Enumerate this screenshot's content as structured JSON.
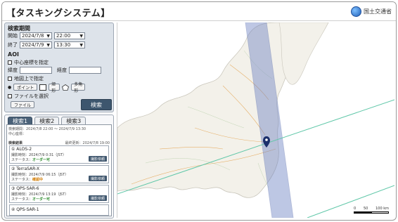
{
  "app": {
    "title": "【タスキングシステム】",
    "brand": "国土交通省"
  },
  "search": {
    "section_title": "検索期間",
    "start_label": "開始",
    "start_date": "2024/7/8",
    "start_time": "22:00",
    "end_label": "終了",
    "end_date": "2024/7/9",
    "end_time": "13:30",
    "aoi_title": "AOI",
    "center_label": "中心座標を指定",
    "lat_label": "緯度",
    "lon_label": "経度",
    "lat_value": "",
    "lon_value": "",
    "map_label": "地図上で指定",
    "point_label": "ポイント",
    "rect_label": "矩形",
    "polygon_label": "多角形",
    "file_check_label": "ファイルを選択",
    "file_button": "ファイル",
    "search_button": "検索"
  },
  "results": {
    "tabs": [
      {
        "label": "検索1"
      },
      {
        "label": "検索2"
      },
      {
        "label": "検索3"
      }
    ],
    "period_text": "検索期間：2024/7/8 22:00 〜 2024/7/9 13:30",
    "center_text": "中心座標：",
    "result_header": "検索結果",
    "updated_text": "最終更新：2024/7/8 19:00",
    "request_label": "撮影依頼",
    "items": [
      {
        "name": "① ALOS-2",
        "time": "撮影時刻：2024/7/9 0:31（JST）",
        "status_label": "ステータス：",
        "status": "オーダー可"
      },
      {
        "name": "② TerraSAR-X",
        "time": "撮影時刻：2024/7/9 06:15（JST）",
        "status_label": "ステータス：",
        "status": "確認中"
      },
      {
        "name": "③ QPS-SAR-6",
        "time": "撮影時刻：2024/7/9 13:19（JST）",
        "status_label": "ステータス：",
        "status": "オーダー可"
      },
      {
        "name": "④ QPS-SAR-1"
      }
    ]
  },
  "map": {
    "scale": {
      "labels": [
        "0",
        "50",
        "100 km"
      ]
    },
    "colors": {
      "swath": "#6f84c4",
      "track": "#5fc7a8",
      "pin": "#1b2f6b"
    }
  }
}
